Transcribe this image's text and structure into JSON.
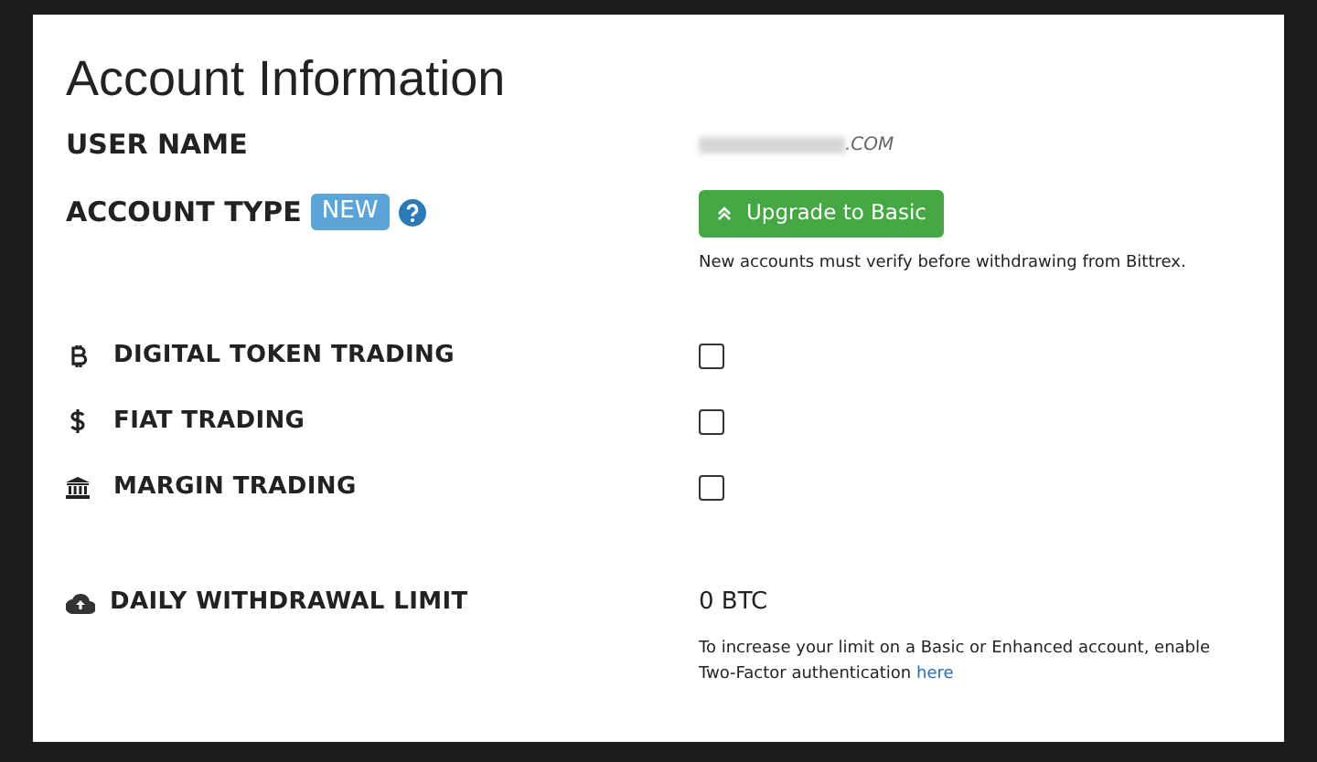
{
  "title": "Account Information",
  "user_name": {
    "label": "USER NAME",
    "value": ".COM"
  },
  "account_type": {
    "label": "ACCOUNT TYPE",
    "badge": "NEW",
    "button": "Upgrade to Basic",
    "note": "New accounts must verify before withdrawing from Bittrex."
  },
  "permissions": [
    {
      "kind": "bitcoin",
      "label": "DIGITAL TOKEN TRADING",
      "checked": false
    },
    {
      "kind": "dollar",
      "label": "FIAT TRADING",
      "checked": false
    },
    {
      "kind": "bank",
      "label": "MARGIN TRADING",
      "checked": false
    }
  ],
  "withdrawal": {
    "label": "DAILY WITHDRAWAL LIMIT",
    "value": "0 BTC",
    "note": "To increase your limit on a Basic or Enhanced account, enable Two-Factor authentication",
    "link": "here"
  }
}
